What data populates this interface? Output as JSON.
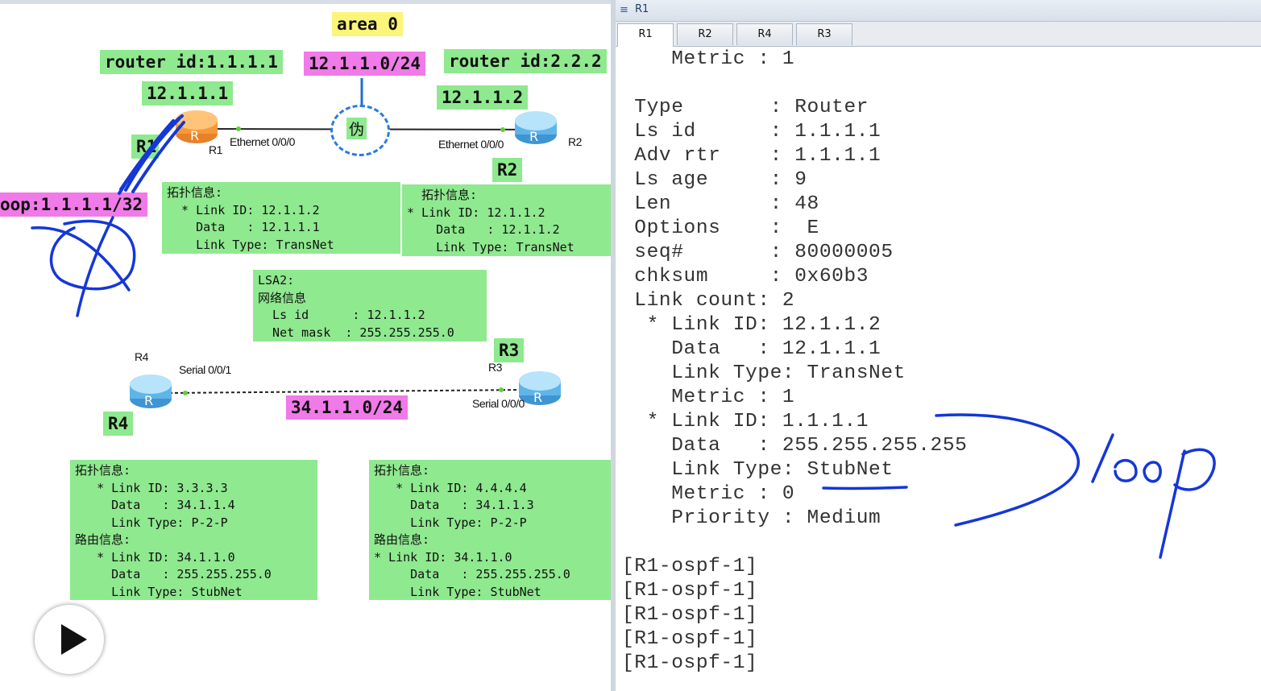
{
  "diagram": {
    "area": "area 0",
    "r1_router_id": "router id:1.1.1.1",
    "network": "12.1.1.0/24",
    "r2_router_id": "router id:2.2.2",
    "r1_ip": "12.1.1.1",
    "r2_ip": "12.1.1.2",
    "r1_partial": "R1",
    "r1_name": "R1",
    "r1_eth": "Ethernet 0/0/0",
    "pseudo_node": "伪",
    "r2_eth": "Ethernet 0/0/0",
    "r2_name": "R2",
    "r2_label": "R2",
    "loopback": "oop:1.1.1.1/32",
    "box1": [
      "拓扑信息:",
      "  * Link ID: 12.1.1.2",
      "    Data   : 12.1.1.1",
      "    Link Type: TransNet"
    ],
    "box2": [
      "  拓扑信息:",
      "* Link ID: 12.1.1.2",
      "    Data   : 12.1.1.2",
      "    Link Type: TransNet"
    ],
    "lsa2": [
      "LSA2:",
      "网络信息",
      "  Ls id      : 12.1.1.2",
      "  Net mask  : 255.255.255.0"
    ],
    "r3_label": "R3",
    "r4_name": "R4",
    "r4_serial": "Serial 0/0/1",
    "r3_name": "R3",
    "serial_net": "34.1.1.0/24",
    "r3_serial": "Serial 0/0/0",
    "r4_label": "R4",
    "box3": [
      "拓扑信息:",
      "   * Link ID: 3.3.3.3",
      "     Data   : 34.1.1.4",
      "     Link Type: P-2-P",
      "路由信息:",
      "   * Link ID: 34.1.1.0",
      "     Data   : 255.255.255.0",
      "     Link Type: StubNet"
    ],
    "box4": [
      "拓扑信息:",
      "   * Link ID: 4.4.4.4",
      "     Data   : 34.1.1.3",
      "     Link Type: P-2-P",
      "路由信息:",
      "* Link ID: 34.1.1.0",
      "     Data   : 255.255.255.0",
      "     Link Type: StubNet"
    ]
  },
  "terminal": {
    "window_title": "R1",
    "tabs": [
      "R1",
      "R2",
      "R4",
      "R3"
    ],
    "active_tab": "R1",
    "lines": [
      "    Metric : 1",
      "",
      " Type       : Router",
      " Ls id      : 1.1.1.1",
      " Adv rtr    : 1.1.1.1",
      " Ls age     : 9",
      " Len        : 48",
      " Options    :  E",
      " seq#       : 80000005",
      " chksum     : 0x60b3",
      " Link count: 2",
      "  * Link ID: 12.1.1.2",
      "    Data   : 12.1.1.1",
      "    Link Type: TransNet",
      "    Metric : 1",
      "  * Link ID: 1.1.1.1",
      "    Data   : 255.255.255.255",
      "    Link Type: StubNet",
      "    Metric : 0",
      "    Priority : Medium",
      "",
      "[R1-ospf-1]",
      "[R1-ospf-1]",
      "[R1-ospf-1]",
      "[R1-ospf-1]",
      "[R1-ospf-1]"
    ]
  },
  "colors": {
    "label_green": "#8fe98f",
    "label_magenta": "#f07ae8",
    "label_yellow": "#fbf57a",
    "annotation_blue": "#1437d8",
    "router_blue": "#5fb5e8",
    "router_orange": "#f59a3a"
  },
  "icons": [
    "router-icon",
    "pseudo-node-icon",
    "play-icon",
    "terminal-icon"
  ]
}
